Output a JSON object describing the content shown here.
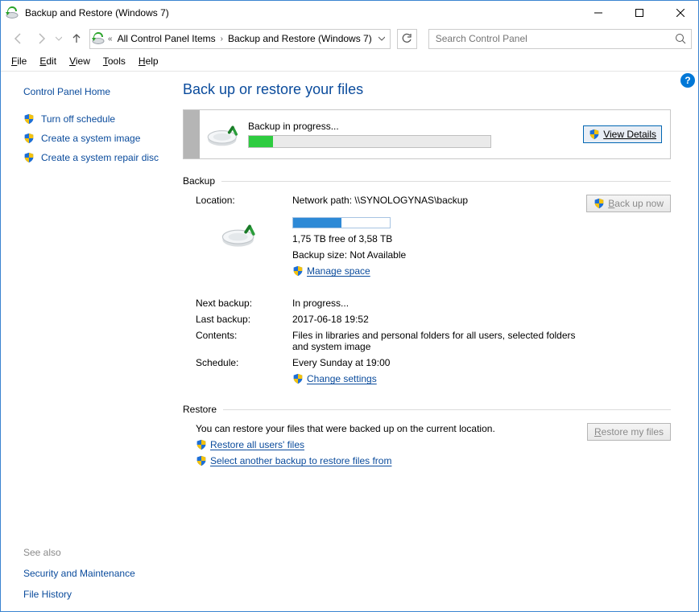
{
  "window": {
    "title": "Backup and Restore (Windows 7)"
  },
  "breadcrumb": {
    "item1": "All Control Panel Items",
    "item2": "Backup and Restore (Windows 7)"
  },
  "search": {
    "placeholder": "Search Control Panel"
  },
  "menu": {
    "file": "File",
    "edit": "Edit",
    "view": "View",
    "tools": "Tools",
    "help": "Help"
  },
  "sidebar": {
    "home": "Control Panel Home",
    "links": {
      "turn_off": "Turn off schedule",
      "create_image": "Create a system image",
      "create_disc": "Create a system repair disc"
    },
    "see_also": "See also",
    "security": "Security and Maintenance",
    "history": "File History"
  },
  "page": {
    "title": "Back up or restore your files"
  },
  "status": {
    "label": "Backup in progress...",
    "progress_pct": 10,
    "details_btn": "View Details"
  },
  "backup": {
    "section": "Backup",
    "location_lbl": "Location:",
    "location_val": "Network path: \\\\SYNOLOGYNAS\\backup",
    "usage_pct": 50,
    "free_line": "1,75 TB free of 3,58 TB",
    "size_line": "Backup size: Not Available",
    "manage": "Manage space",
    "backup_now": "Back up now",
    "next_lbl": "Next backup:",
    "next_val": "In progress...",
    "last_lbl": "Last backup:",
    "last_val": "2017-06-18 19:52",
    "contents_lbl": "Contents:",
    "contents_val": "Files in libraries and personal folders for all users, selected folders and system image",
    "sched_lbl": "Schedule:",
    "sched_val": "Every Sunday at 19:00",
    "change": "Change settings"
  },
  "restore": {
    "section": "Restore",
    "text": "You can restore your files that were backed up on the current location.",
    "btn": "Restore my files",
    "all_users": "Restore all users' files",
    "another_pre": "Select ",
    "another_mid": "a",
    "another_post": "nother backup to restore files from"
  }
}
